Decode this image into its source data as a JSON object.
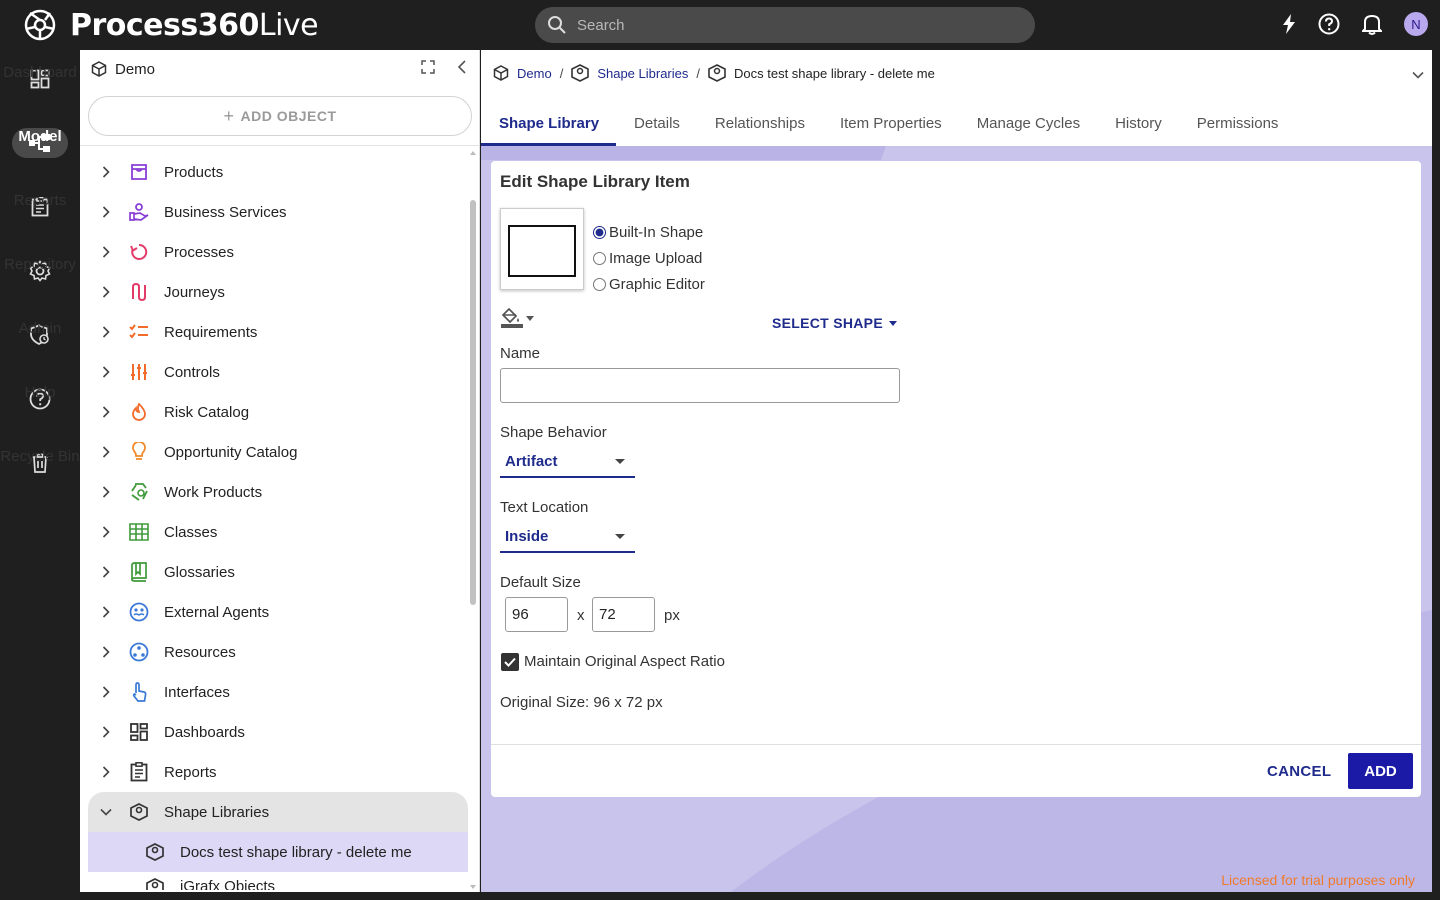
{
  "app": {
    "logo_bold": "Process360",
    "logo_light": "Live",
    "search_placeholder": "Search",
    "avatar_initial": "N"
  },
  "rail": {
    "items": [
      {
        "label": "Dashboard",
        "icon": "dashboard-icon"
      },
      {
        "label": "Model",
        "icon": "model-icon"
      },
      {
        "label": "Reports",
        "icon": "reports-icon"
      },
      {
        "label": "Repository",
        "icon": "gear-icon"
      },
      {
        "label": "Admin",
        "icon": "admin-icon"
      },
      {
        "label": "Help",
        "icon": "help-icon"
      },
      {
        "label": "Recycle Bin",
        "icon": "trash-icon"
      }
    ]
  },
  "tree": {
    "root": "Demo",
    "add_object": "ADD OBJECT",
    "items": [
      {
        "label": "Products",
        "color": "#8a3fd6"
      },
      {
        "label": "Business Services",
        "color": "#8a3fd6"
      },
      {
        "label": "Processes",
        "color": "#e23c6a"
      },
      {
        "label": "Journeys",
        "color": "#e23c6a"
      },
      {
        "label": "Requirements",
        "color": "#f26b2a"
      },
      {
        "label": "Controls",
        "color": "#f26b2a"
      },
      {
        "label": "Risk Catalog",
        "color": "#f26b2a"
      },
      {
        "label": "Opportunity Catalog",
        "color": "#f28a2a"
      },
      {
        "label": "Work Products",
        "color": "#3f9a3a"
      },
      {
        "label": "Classes",
        "color": "#3f9a3a"
      },
      {
        "label": "Glossaries",
        "color": "#3f9a3a"
      },
      {
        "label": "External Agents",
        "color": "#3a7ad6"
      },
      {
        "label": "Resources",
        "color": "#3a7ad6"
      },
      {
        "label": "Interfaces",
        "color": "#3a7ad6"
      },
      {
        "label": "Dashboards",
        "color": "#333333"
      },
      {
        "label": "Reports",
        "color": "#333333"
      }
    ],
    "selected": "Shape Libraries",
    "child": "Docs test shape library - delete me",
    "next_child": "iGrafx Objects"
  },
  "breadcrumb": {
    "root": "Demo",
    "section": "Shape Libraries",
    "current": "Docs test shape library - delete me"
  },
  "tabs": [
    "Shape Library",
    "Details",
    "Relationships",
    "Item Properties",
    "Manage Cycles",
    "History",
    "Permissions"
  ],
  "form": {
    "title": "Edit Shape Library Item",
    "radio_builtin": "Built-In Shape",
    "radio_image": "Image Upload",
    "radio_graphic": "Graphic Editor",
    "select_shape": "SELECT SHAPE",
    "name_label": "Name",
    "name_value": "",
    "behavior_label": "Shape Behavior",
    "behavior_value": "Artifact",
    "text_location_label": "Text Location",
    "text_location_value": "Inside",
    "default_size_label": "Default Size",
    "width": "96",
    "height": "72",
    "times": "x",
    "unit": "px",
    "aspect_label": "Maintain Original Aspect Ratio",
    "original_size": "Original Size: 96 x 72 px",
    "cancel": "CANCEL",
    "add": "ADD"
  },
  "license_notice": "Licensed for trial purposes only",
  "colors": {
    "accent": "#1f2b8c",
    "primary_button": "#1a1aa6",
    "main_bg": "#c9c4ec",
    "license": "#f07a2a"
  }
}
